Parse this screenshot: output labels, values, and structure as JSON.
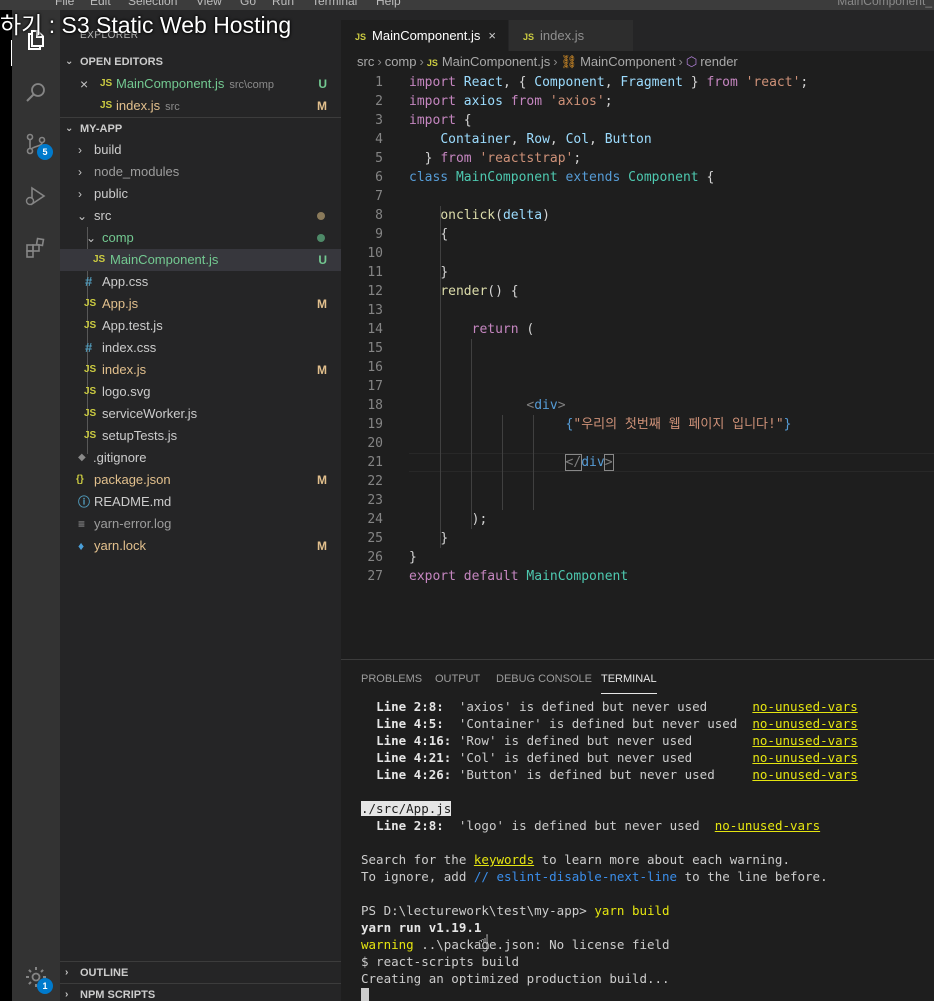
{
  "menubar": {
    "items": [
      "File",
      "Edit",
      "Selection",
      "View",
      "Go",
      "Run",
      "Terminal",
      "Help"
    ],
    "window_title": "MainComponent_"
  },
  "overlay_title": "하기 : S3 Static Web Hosting",
  "activity": {
    "source_control_badge": "5",
    "accounts_badge": "1"
  },
  "sidebar": {
    "title": "EXPLORER",
    "open_editors": {
      "label": "OPEN EDITORS",
      "items": [
        {
          "icon": "JS",
          "name": "MainComponent.js",
          "desc": "src\\comp",
          "status": "U"
        },
        {
          "icon": "JS",
          "name": "index.js",
          "desc": "src",
          "status": "M"
        }
      ]
    },
    "project": {
      "label": "MY-APP",
      "tree": [
        {
          "kind": "folder",
          "name": "build",
          "chev": "›"
        },
        {
          "kind": "folder",
          "name": "node_modules",
          "chev": "›"
        },
        {
          "kind": "folder",
          "name": "public",
          "chev": "›"
        },
        {
          "kind": "folder",
          "name": "src",
          "chev": "⌄"
        },
        {
          "kind": "folder",
          "name": "comp",
          "chev": "⌄"
        },
        {
          "kind": "file",
          "icon": "JS",
          "name": "MainComponent.js",
          "status": "U"
        },
        {
          "kind": "file",
          "icon": "#",
          "name": "App.css",
          "status": ""
        },
        {
          "kind": "file",
          "icon": "JS",
          "name": "App.js",
          "status": "M"
        },
        {
          "kind": "file",
          "icon": "JS",
          "name": "App.test.js",
          "status": ""
        },
        {
          "kind": "file",
          "icon": "#",
          "name": "index.css",
          "status": ""
        },
        {
          "kind": "file",
          "icon": "JS",
          "name": "index.js",
          "status": "M"
        },
        {
          "kind": "file",
          "icon": "JS",
          "name": "logo.svg",
          "status": ""
        },
        {
          "kind": "file",
          "icon": "JS",
          "name": "serviceWorker.js",
          "status": ""
        },
        {
          "kind": "file",
          "icon": "JS",
          "name": "setupTests.js",
          "status": ""
        },
        {
          "kind": "file",
          "icon": "◆",
          "name": ".gitignore",
          "status": ""
        },
        {
          "kind": "file",
          "icon": "{}",
          "name": "package.json",
          "status": "M"
        },
        {
          "kind": "file",
          "icon": "ⓘ",
          "name": "README.md",
          "status": ""
        },
        {
          "kind": "file",
          "icon": "≡",
          "name": "yarn-error.log",
          "status": ""
        },
        {
          "kind": "file",
          "icon": "♦",
          "name": "yarn.lock",
          "status": "M"
        }
      ]
    },
    "outline_label": "OUTLINE",
    "npm_scripts_label": "NPM SCRIPTS"
  },
  "tabs": [
    {
      "icon": "JS",
      "label": "MainComponent.js",
      "close": "×",
      "active": true
    },
    {
      "icon": "JS",
      "label": "index.js",
      "active": false
    }
  ],
  "breadcrumbs": {
    "parts": [
      "src",
      "comp",
      "MainComponent.js",
      "MainComponent",
      "render"
    ]
  },
  "editor": {
    "line_numbers": [
      "1",
      "2",
      "3",
      "4",
      "5",
      "6",
      "7",
      "8",
      "9",
      "10",
      "11",
      "12",
      "13",
      "14",
      "15",
      "16",
      "17",
      "18",
      "19",
      "20",
      "21",
      "22",
      "23",
      "24",
      "25",
      "26",
      "27"
    ],
    "code": {
      "l1": [
        "import",
        "React",
        ", { ",
        "Component",
        ", ",
        "Fragment",
        " } ",
        "from",
        "'react'",
        ";"
      ],
      "l2": [
        "import",
        "axios",
        "from",
        "'axios'",
        ";"
      ],
      "l3": [
        "import",
        "{"
      ],
      "l4": [
        "Container",
        ", ",
        "Row",
        ", ",
        "Col",
        ", ",
        "Button"
      ],
      "l5": [
        "} ",
        "from",
        "'reactstrap'",
        ";"
      ],
      "l6": [
        "class",
        "MainComponent",
        "extends",
        "Component",
        " {"
      ],
      "l8": [
        "onclick",
        "(",
        "delta",
        ")"
      ],
      "l9": [
        "{"
      ],
      "l11": [
        "}"
      ],
      "l12": [
        "render",
        "() {"
      ],
      "l14": [
        "return",
        " ("
      ],
      "l18": [
        "<",
        "div",
        ">"
      ],
      "l19": [
        "{",
        "\"우리의 첫번째 웹 페이지 입니다!\"",
        "}"
      ],
      "l21": [
        "</",
        "div",
        ">"
      ],
      "l24": [
        ");"
      ],
      "l25": [
        "}"
      ],
      "l26": [
        "}"
      ],
      "l27": [
        "export",
        "default",
        "MainComponent"
      ]
    }
  },
  "panel": {
    "tabs": [
      "PROBLEMS",
      "OUTPUT",
      "DEBUG CONSOLE",
      "TERMINAL"
    ],
    "warnings": [
      {
        "loc": "Line 2:8:",
        "msg": "'axios' is defined but never used",
        "rule": "no-unused-vars"
      },
      {
        "loc": "Line 4:5:",
        "msg": "'Container' is defined but never used",
        "rule": "no-unused-vars"
      },
      {
        "loc": "Line 4:16:",
        "msg": "'Row' is defined but never used",
        "rule": "no-unused-vars"
      },
      {
        "loc": "Line 4:21:",
        "msg": "'Col' is defined but never used",
        "rule": "no-unused-vars"
      },
      {
        "loc": "Line 4:26:",
        "msg": "'Button' is defined but never used",
        "rule": "no-unused-vars"
      }
    ],
    "app_file": "./src/App.js",
    "app_warning": {
      "loc": "Line 2:8:",
      "msg": "'logo' is defined but never used",
      "rule": "no-unused-vars"
    },
    "search_line": {
      "pre": "Search for the ",
      "link": "keywords",
      "post": " to learn more about each warning."
    },
    "ignore_line": {
      "pre": "To ignore, add ",
      "link": "// eslint-disable-next-line",
      "post": " to the line before."
    },
    "prompt": "PS D:\\lecturework\\test\\my-app>",
    "command": "yarn build",
    "yarn_run": "yarn run v1.19.1",
    "warning_line": {
      "label": "warning",
      "path": "..\\package.json",
      "msg": ": No license field"
    },
    "react_scripts": "$ react-scripts build",
    "creating": "Creating an optimized production build..."
  }
}
